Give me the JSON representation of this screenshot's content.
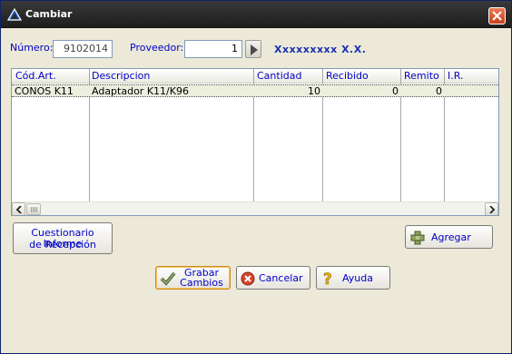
{
  "window": {
    "title": "Cambiar"
  },
  "header": {
    "numero_label": "Número:",
    "numero_value": "9102014",
    "proveedor_label": "Proveedor:",
    "proveedor_value": "1",
    "proveedor_name": "Xxxxxxxxx X.X."
  },
  "grid": {
    "columns": [
      "Cód.Art.",
      "Descripcion",
      "Cantidad",
      "Recibido",
      "Remito",
      "I.R."
    ],
    "rows": [
      {
        "cod": "CONOS K11",
        "descripcion": "Adaptador K11/K96",
        "cantidad": "10",
        "recibido": "0",
        "remito": "0",
        "ir": ""
      }
    ]
  },
  "buttons": {
    "cuestionario_line1": "Cuestionario Informe",
    "cuestionario_line2": "de Recepción",
    "agregar": "Agregar",
    "grabar_line1": "Grabar",
    "grabar_line2": "Cambios",
    "cancelar": "Cancelar",
    "ayuda": "Ayuda"
  },
  "colors": {
    "label": "#0000c8",
    "title_bar": "#2b2b2b",
    "close": "#c9401c"
  },
  "icons": {
    "title": "triangle-logo-icon",
    "close": "close-icon",
    "go": "arrow-right-icon",
    "agregar": "add-cross-icon",
    "grabar": "checkmark-icon",
    "cancelar": "cancel-icon",
    "ayuda": "help-question-icon"
  }
}
